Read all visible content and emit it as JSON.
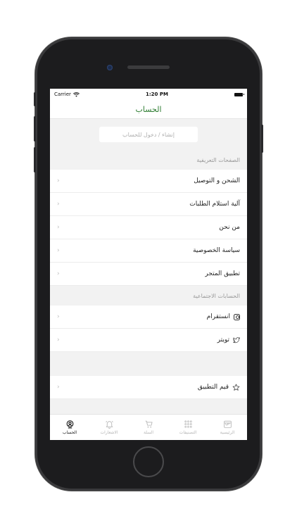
{
  "status_bar": {
    "carrier": "Carrier",
    "time": "1:20 PM"
  },
  "nav": {
    "title": "الحساب"
  },
  "login": {
    "label": "إنشاء / دخول للحساب"
  },
  "sections": {
    "pages": {
      "header": "الصفحات التعريفية",
      "items": [
        {
          "label": "الشحن و التوصيل"
        },
        {
          "label": "آلية استلام الطلبات"
        },
        {
          "label": "من نحن"
        },
        {
          "label": "سياسة الخصوصية"
        },
        {
          "label": "تطبيق المتجر"
        }
      ]
    },
    "social": {
      "header": "الحسابات الاجتماعية",
      "items": [
        {
          "label": "انستقرام",
          "icon": "instagram-icon"
        },
        {
          "label": "تويتر",
          "icon": "twitter-icon"
        }
      ]
    },
    "rate": {
      "label": "قيم التطبيق",
      "icon": "star-icon"
    }
  },
  "chevron": "‹",
  "tabs": [
    {
      "label": "الحساب",
      "icon": "account-icon",
      "active": true
    },
    {
      "label": "الاشعارات",
      "icon": "bell-icon",
      "active": false
    },
    {
      "label": "السلة",
      "icon": "cart-icon",
      "active": false
    },
    {
      "label": "التصنيفات",
      "icon": "grid-icon",
      "active": false
    },
    {
      "label": "الرئيسية",
      "icon": "store-icon",
      "active": false
    }
  ],
  "colors": {
    "accent": "#2e7d32",
    "background": "#f2f2f2",
    "inactive_tab": "#b5b5b5"
  }
}
